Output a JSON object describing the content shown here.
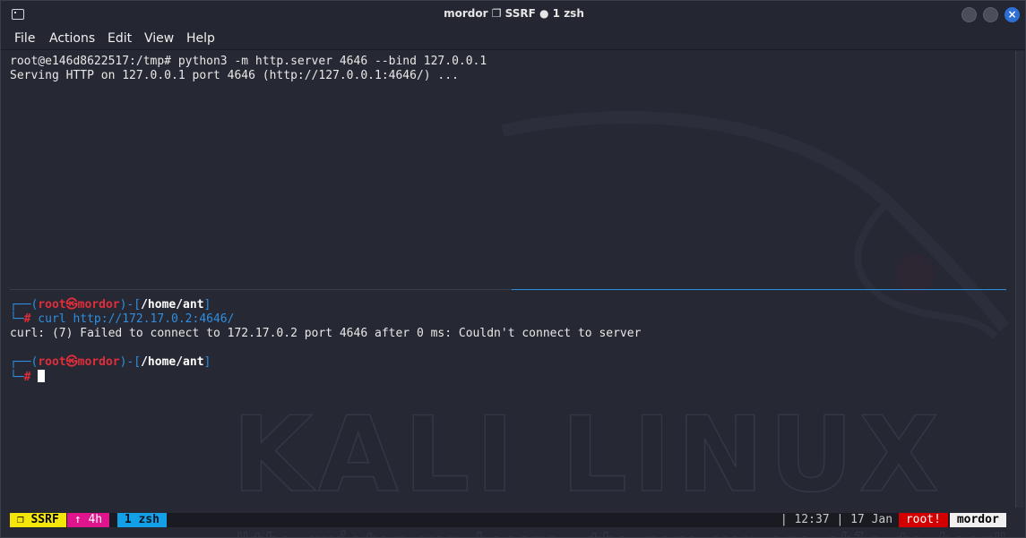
{
  "window": {
    "title": "mordor ❐ SSRF ● 1 zsh"
  },
  "menu": [
    "File",
    "Actions",
    "Edit",
    "View",
    "Help"
  ],
  "pane_top": {
    "line1": "root@e146d8622517:/tmp# python3 -m http.server 4646 --bind 127.0.0.1",
    "line2": "Serving HTTP on 127.0.0.1 port 4646 (http://127.0.0.1:4646/) ..."
  },
  "pane_bottom": {
    "prompt_open": "┌──(",
    "user": "root",
    "at": "㉿",
    "host": "mordor",
    "bracket_mid": ")-[",
    "cwd": "/home/ant",
    "bracket_close": "]",
    "prompt_hash_prefix": "└─",
    "hash": "#",
    "command": " curl http://172.17.0.2:4646/",
    "output": "curl: (7) Failed to connect to 172.17.0.2 port 4646 after 0 ms: Couldn't connect to server"
  },
  "watermark": {
    "big": "KALI LINUX",
    "quote": "\"the quieter you become, the more you are able to hear\""
  },
  "status": {
    "session": " ❐ SSRF ",
    "uptime": " ↑ 4h ",
    "window": " 1 zsh ",
    "time": " | 12:37 | 17 Jan ",
    "user": " root! ",
    "host": " mordor "
  },
  "colors": {
    "accent_blue": "#2f8ee0",
    "prompt_red": "#e02e3b",
    "session_yellow": "#f5e60a",
    "uptime_magenta": "#e0148c",
    "window_cyan": "#14a0e6",
    "root_red": "#d40000",
    "host_bg": "#f0f0f0"
  }
}
